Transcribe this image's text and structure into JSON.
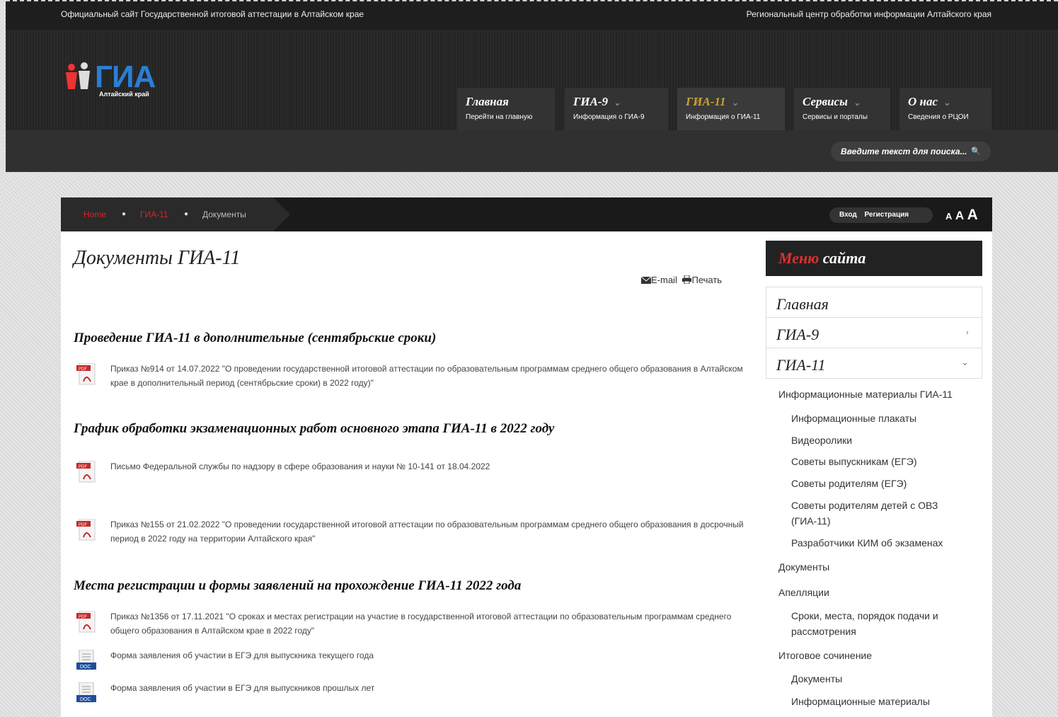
{
  "top": {
    "left_text": "Официальный сайт Государственной итоговой аттестации в Алтайском крае",
    "right_text": "Региональный центр обработки информации Алтайского края"
  },
  "logo": {
    "word": "ГИА",
    "region": "Алтайский край"
  },
  "nav": [
    {
      "label": "Главная",
      "sub": "Перейти на главную",
      "has_dropdown": false,
      "active": false
    },
    {
      "label": "ГИА-9",
      "sub": "Информация о ГИА-9",
      "has_dropdown": true,
      "active": false
    },
    {
      "label": "ГИА-11",
      "sub": "Информация о ГИА-11",
      "has_dropdown": true,
      "active": true
    },
    {
      "label": "Сервисы",
      "sub": "Сервисы и порталы",
      "has_dropdown": true,
      "active": false
    },
    {
      "label": "О нас",
      "sub": "Сведения о РЦОИ",
      "has_dropdown": true,
      "active": false
    }
  ],
  "search": {
    "placeholder": "Введите текст для поиска..."
  },
  "breadcrumb": {
    "home": "Home",
    "section": "ГИА-11",
    "current": "Документы"
  },
  "auth": {
    "login": "Вход",
    "register": "Регистрация"
  },
  "font_size": [
    "A",
    "A",
    "A"
  ],
  "page": {
    "title": "Документы ГИА-11",
    "email": "E-mail",
    "print": "Печать"
  },
  "sections": [
    {
      "title": "Проведение ГИА-11 в дополнительные (сентябрьские сроки)",
      "docs": [
        {
          "type": "pdf",
          "text": "Приказ №914 от 14.07.2022 \"О проведении государственной итоговой аттестации по образовательным программам среднего общего образования в Алтайском крае в дополнительный период (сентябрьские сроки) в 2022 году)\""
        }
      ]
    },
    {
      "title": "График обработки экзаменационных работ основного этапа ГИА-11 в 2022 году",
      "docs": [
        {
          "type": "pdf",
          "text": "Письмо Федеральной службы по надзору в сфере образования и науки № 10-141 от 18.04.2022"
        },
        {
          "type": "pdf",
          "text": "Приказ №155 от 21.02.2022 \"О проведении государственной итоговой аттестации по образовательным программам среднего общего образования в досрочный период в 2022 году на территории Алтайского края\""
        }
      ]
    },
    {
      "title": "Места регистрации и формы заявлений на прохождение ГИА-11 2022 года",
      "docs": [
        {
          "type": "pdf",
          "text": "Приказ №1356 от 17.11.2021 \"О сроках и местах регистрации на участие в государственной итоговой аттестации по образовательным программам среднего общего образования в Алтайском крае в 2022 году\""
        },
        {
          "type": "doc",
          "text": "Форма заявления об участии в ЕГЭ для выпускника текущего года"
        },
        {
          "type": "doc",
          "text": "Форма заявления об участии в ЕГЭ  для выпускников прошлых лет"
        }
      ]
    }
  ],
  "sidebar": {
    "title_red": "Меню",
    "title_white": "сайта",
    "main": [
      {
        "label": "Главная",
        "arrow": ""
      },
      {
        "label": "ГИА-9",
        "arrow": "›"
      },
      {
        "label": "ГИА-11",
        "arrow": "⌄"
      }
    ],
    "items": [
      {
        "level": 1,
        "label": "Информационные материалы ГИА-11"
      },
      {
        "level": 2,
        "label": "Информационные плакаты"
      },
      {
        "level": 2,
        "label": "Видеоролики"
      },
      {
        "level": 2,
        "label": "Советы выпускникам (ЕГЭ)"
      },
      {
        "level": 2,
        "label": "Советы родителям (ЕГЭ)"
      },
      {
        "level": 2,
        "label": "Советы родителям детей с ОВЗ (ГИА-11)"
      },
      {
        "level": 2,
        "label": "Разработчики КИМ об экзаменах"
      },
      {
        "level": 1,
        "label": "Документы"
      },
      {
        "level": 1,
        "label": "Апелляции"
      },
      {
        "level": 2,
        "label": "Сроки, места, порядок подачи и рассмотрения"
      },
      {
        "level": 1,
        "label": "Итоговое сочинение"
      },
      {
        "level": 2,
        "label": "Документы"
      },
      {
        "level": 2,
        "label": "Информационные материалы"
      }
    ]
  }
}
